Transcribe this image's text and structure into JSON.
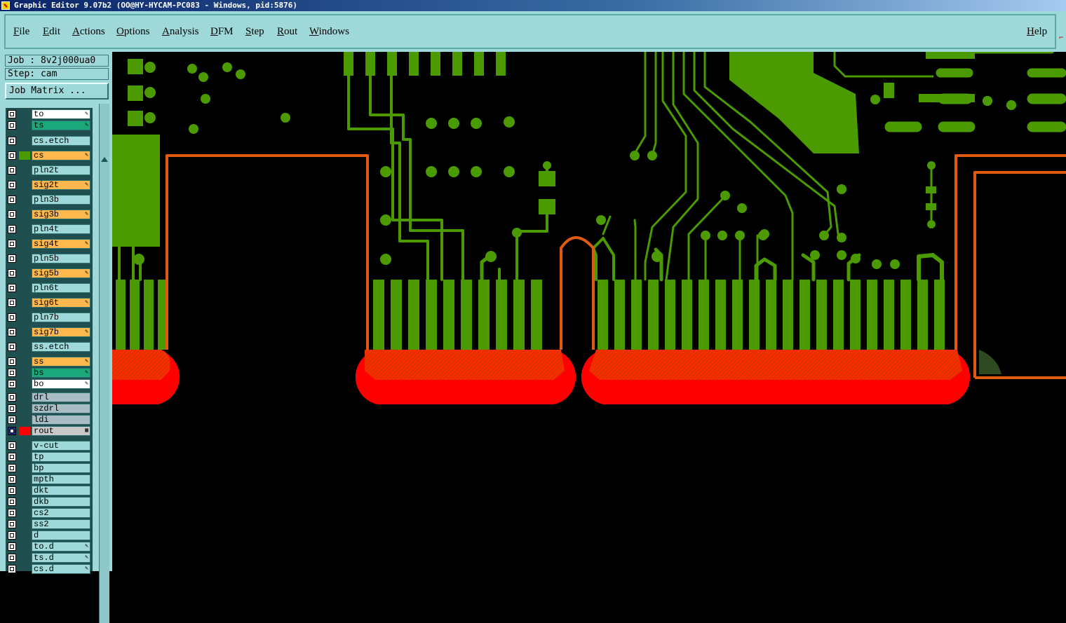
{
  "window": {
    "title": "Graphic Editor 9.07b2 (OO@HY-HYCAM-PC083 - Windows, pid:5876)"
  },
  "menu": {
    "items": [
      {
        "label": "File",
        "hot": "F"
      },
      {
        "label": "Edit",
        "hot": "E"
      },
      {
        "label": "Actions",
        "hot": "A"
      },
      {
        "label": "Options",
        "hot": "O"
      },
      {
        "label": "Analysis",
        "hot": "A"
      },
      {
        "label": "DFM",
        "hot": "D"
      },
      {
        "label": "Step",
        "hot": "S"
      },
      {
        "label": "Rout",
        "hot": "R"
      },
      {
        "label": "Windows",
        "hot": "W"
      }
    ],
    "help": {
      "label": "Help",
      "hot": "H"
    }
  },
  "job": {
    "job_label": "Job : 8v2j000ua0",
    "step_label": "Step: cam",
    "matrix_button": "Job Matrix ..."
  },
  "colors": {
    "copper": "#4a9a00",
    "rout": "#ff0000",
    "rout_outline": "#e05a10",
    "panel_bg": "#9ed8d8",
    "layer_signal": "#ffb84d",
    "layer_silk": "#ffffff",
    "layer_mask": "#1aa87a",
    "layer_drill": "#a8bcc4",
    "layer_default": "#9ed8d8"
  },
  "layers": [
    {
      "name": "to",
      "bg": "#ffffff",
      "marker": "pencil-icon",
      "swatch": ""
    },
    {
      "name": "ts",
      "bg": "#1aa87a",
      "marker": "pencil-icon",
      "swatch": ""
    },
    {
      "name": "cs.etch",
      "bg": "#9ed8d8",
      "marker": "",
      "swatch": ""
    },
    {
      "name": "cs",
      "bg": "#ffb84d",
      "marker": "pencil-icon",
      "swatch": "#4a9a00"
    },
    {
      "name": "pln2t",
      "bg": "#9ed8d8",
      "marker": "",
      "swatch": ""
    },
    {
      "name": "sig2t",
      "bg": "#ffb84d",
      "marker": "pencil-icon",
      "swatch": ""
    },
    {
      "name": "pln3b",
      "bg": "#9ed8d8",
      "marker": "",
      "swatch": ""
    },
    {
      "name": "sig3b",
      "bg": "#ffb84d",
      "marker": "pencil-icon",
      "swatch": ""
    },
    {
      "name": "pln4t",
      "bg": "#9ed8d8",
      "marker": "",
      "swatch": ""
    },
    {
      "name": "sig4t",
      "bg": "#ffb84d",
      "marker": "pencil-icon",
      "swatch": ""
    },
    {
      "name": "pln5b",
      "bg": "#9ed8d8",
      "marker": "",
      "swatch": ""
    },
    {
      "name": "sig5b",
      "bg": "#ffb84d",
      "marker": "pencil-icon",
      "swatch": ""
    },
    {
      "name": "pln6t",
      "bg": "#9ed8d8",
      "marker": "",
      "swatch": ""
    },
    {
      "name": "sig6t",
      "bg": "#ffb84d",
      "marker": "pencil-icon",
      "swatch": ""
    },
    {
      "name": "pln7b",
      "bg": "#9ed8d8",
      "marker": "",
      "swatch": ""
    },
    {
      "name": "sig7b",
      "bg": "#ffb84d",
      "marker": "pencil-icon",
      "swatch": ""
    },
    {
      "name": "ss.etch",
      "bg": "#9ed8d8",
      "marker": "",
      "swatch": ""
    },
    {
      "name": "ss",
      "bg": "#ffb84d",
      "marker": "pencil-icon",
      "swatch": ""
    },
    {
      "name": "bs",
      "bg": "#1aa87a",
      "marker": "pencil-icon",
      "swatch": ""
    },
    {
      "name": "bo",
      "bg": "#ffffff",
      "marker": "pencil-icon",
      "swatch": ""
    },
    {
      "name": "drl",
      "bg": "#a8bcc4",
      "marker": "",
      "swatch": ""
    },
    {
      "name": "szdrl",
      "bg": "#a8bcc4",
      "marker": "",
      "swatch": ""
    },
    {
      "name": "ldi",
      "bg": "#a8bcc4",
      "marker": "",
      "swatch": ""
    },
    {
      "name": "rout",
      "bg": "#c8c8c8",
      "marker": "grid-icon",
      "swatch": "#ff0000",
      "active": true
    },
    {
      "name": "v-cut",
      "bg": "#9ed8d8",
      "marker": "",
      "swatch": ""
    },
    {
      "name": "tp",
      "bg": "#9ed8d8",
      "marker": "",
      "swatch": ""
    },
    {
      "name": "bp",
      "bg": "#9ed8d8",
      "marker": "",
      "swatch": ""
    },
    {
      "name": "mpth",
      "bg": "#9ed8d8",
      "marker": "",
      "swatch": ""
    },
    {
      "name": "dkt",
      "bg": "#9ed8d8",
      "marker": "",
      "swatch": ""
    },
    {
      "name": "dkb",
      "bg": "#9ed8d8",
      "marker": "",
      "swatch": ""
    },
    {
      "name": "cs2",
      "bg": "#9ed8d8",
      "marker": "",
      "swatch": ""
    },
    {
      "name": "ss2",
      "bg": "#9ed8d8",
      "marker": "",
      "swatch": ""
    },
    {
      "name": "d",
      "bg": "#9ed8d8",
      "marker": "",
      "swatch": ""
    },
    {
      "name": "to.d",
      "bg": "#9ed8d8",
      "marker": "pencil-icon",
      "swatch": ""
    },
    {
      "name": "ts.d",
      "bg": "#9ed8d8",
      "marker": "pencil-icon",
      "swatch": ""
    },
    {
      "name": "cs.d",
      "bg": "#9ed8d8",
      "marker": "pencil-icon",
      "swatch": ""
    }
  ]
}
